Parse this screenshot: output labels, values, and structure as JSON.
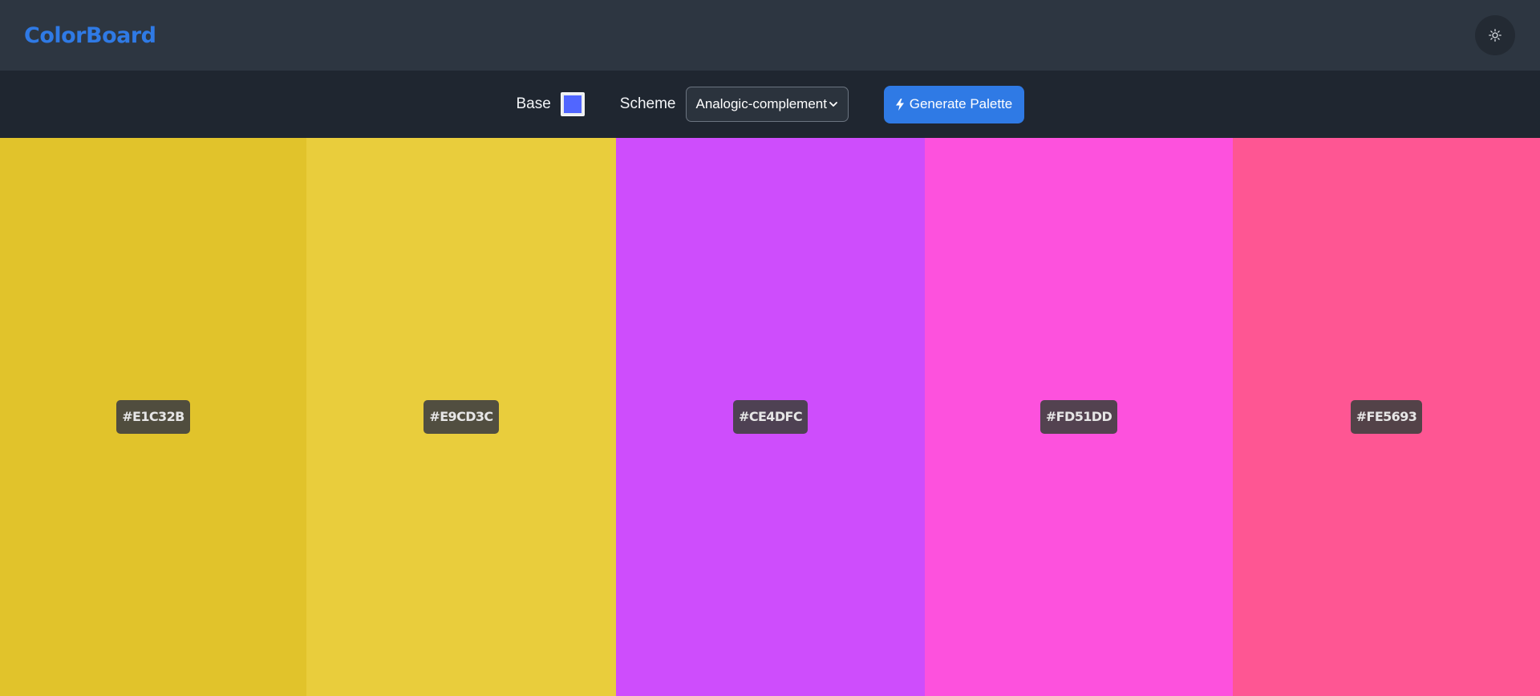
{
  "header": {
    "logo": "ColorBoard",
    "theme_toggle_icon": "sun-icon"
  },
  "toolbar": {
    "base_label": "Base",
    "base_color": "#5166ff",
    "scheme_label": "Scheme",
    "scheme_value": "Analogic-complement",
    "generate_label": "Generate Palette",
    "generate_icon": "bolt-icon"
  },
  "palette": [
    {
      "hex": "#E1C32B",
      "color": "#E1C32B"
    },
    {
      "hex": "#E9CD3C",
      "color": "#E9CD3C"
    },
    {
      "hex": "#CE4DFC",
      "color": "#CE4DFC"
    },
    {
      "hex": "#FD51DD",
      "color": "#FD51DD"
    },
    {
      "hex": "#FE5693",
      "color": "#FE5693"
    }
  ],
  "colors": {
    "accent": "#2f7ae5",
    "header_bg": "#2d3641",
    "toolbar_bg": "#1f2630"
  }
}
